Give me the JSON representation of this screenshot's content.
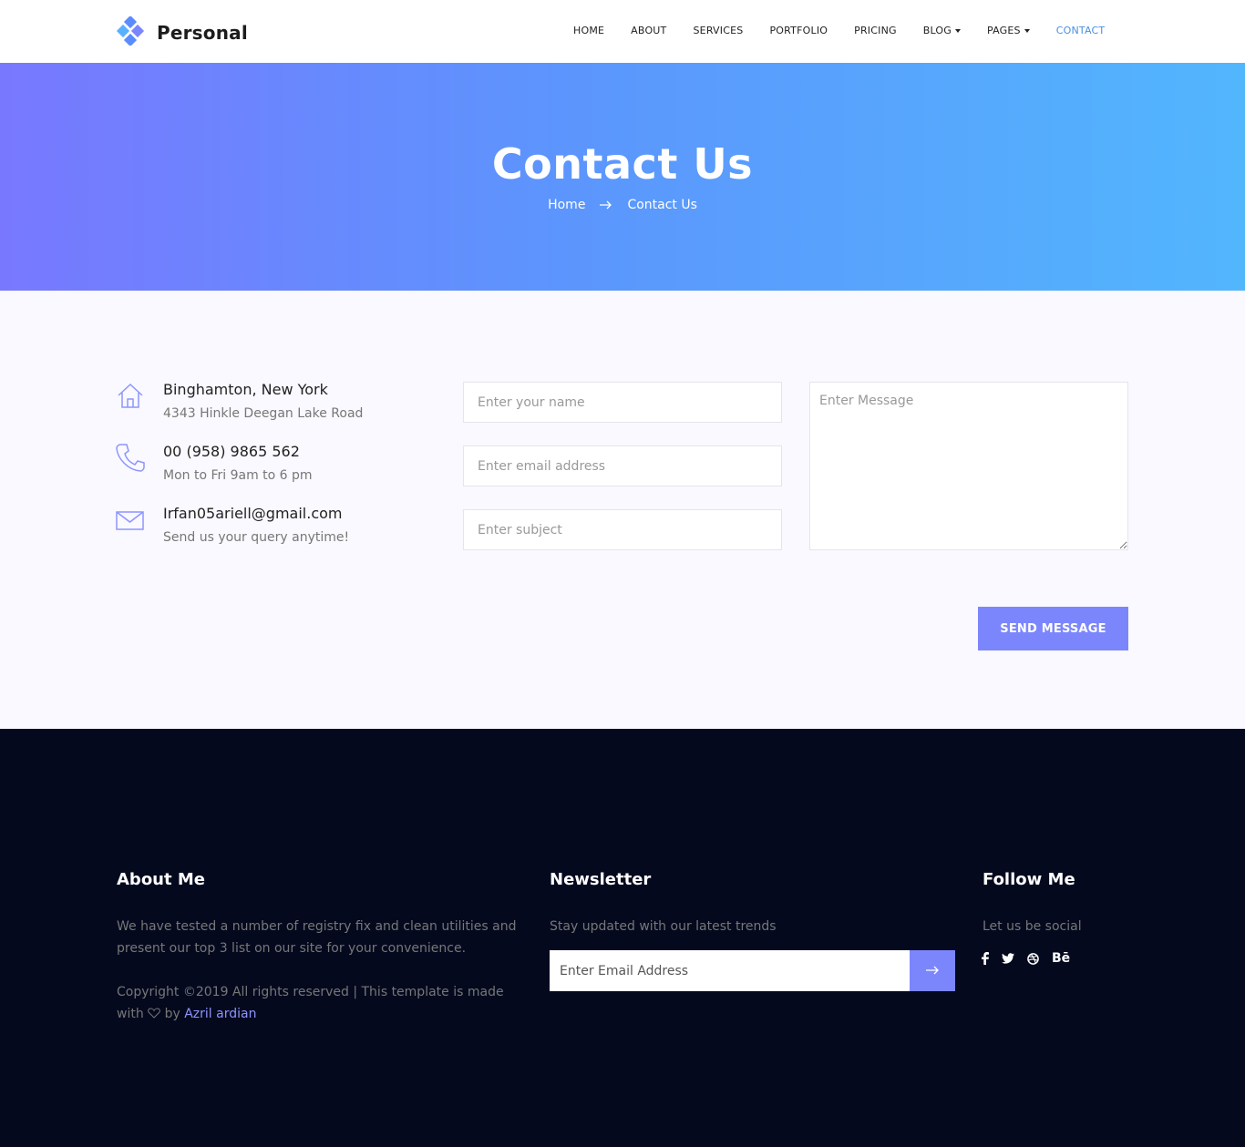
{
  "brand": {
    "name": "Personal",
    "logo_icon": "diamond-cluster-logo"
  },
  "nav": {
    "items": [
      {
        "label": "HOME"
      },
      {
        "label": "ABOUT"
      },
      {
        "label": "SERVICES"
      },
      {
        "label": "PORTFOLIO"
      },
      {
        "label": "PRICING"
      },
      {
        "label": "BLOG"
      },
      {
        "label": "PAGES"
      },
      {
        "label": "CONTACT"
      }
    ],
    "active": "CONTACT"
  },
  "banner": {
    "title": "Contact Us",
    "breadcrumb": [
      "Home",
      "Contact Us"
    ]
  },
  "contact_info": [
    {
      "icon": "home-icon",
      "title": "Binghamton, New York",
      "subtitle": "4343 Hinkle Deegan Lake Road"
    },
    {
      "icon": "phone-icon",
      "title": "00 (958) 9865 562",
      "subtitle": "Mon to Fri 9am to 6 pm"
    },
    {
      "icon": "envelope-icon",
      "title": "Irfan05ariell@gmail.com",
      "subtitle": "Send us your query anytime!"
    }
  ],
  "form": {
    "name_placeholder": "Enter your name",
    "email_placeholder": "Enter email address",
    "subject_placeholder": "Enter subject",
    "message_placeholder": "Enter Message",
    "submit_label": "SEND MESSAGE"
  },
  "footer": {
    "about": {
      "title": "About Me",
      "text": "We have tested a number of registry fix and clean utilities and present our top 3 list on our site for your convenience.",
      "copyright": "Copyright ©2019 All rights reserved | This template is made with",
      "by": "by",
      "author": "Azril ardian"
    },
    "newsletter": {
      "title": "Newsletter",
      "text": "Stay updated with our latest trends",
      "placeholder": "Enter Email Address"
    },
    "follow": {
      "title": "Follow Me",
      "text": "Let us be social",
      "behance_label": "Bē"
    }
  },
  "colors": {
    "accent": "#7c86fc",
    "active_nav": "#4a8fe0",
    "banner_start": "#7878fe",
    "banner_end": "#52b6fd",
    "footer_bg": "#04091e",
    "page_bg": "#f9f9ff"
  }
}
